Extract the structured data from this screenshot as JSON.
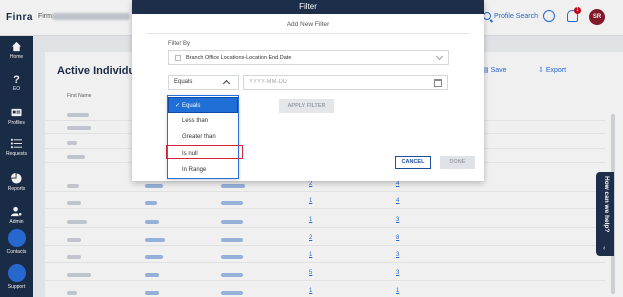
{
  "topbar": {
    "logo": "Finra",
    "firm_label": "Firm:",
    "profile_search": "Profile Search",
    "notification_count": "1",
    "avatar_initials": "SR"
  },
  "sidebar": {
    "items": [
      {
        "label": "Home",
        "icon": "home-icon"
      },
      {
        "label": "EO",
        "icon": "question-icon"
      },
      {
        "label": "Profiles",
        "icon": "id-card-icon"
      },
      {
        "label": "Requests",
        "icon": "list-icon"
      },
      {
        "label": "Reports",
        "icon": "pie-chart-icon"
      },
      {
        "label": "Admin",
        "icon": "user-gear-icon"
      },
      {
        "label": "Contacts",
        "icon": "contacts-icon"
      },
      {
        "label": "Support",
        "icon": "link-icon"
      }
    ]
  },
  "main": {
    "title": "Active Individu",
    "save_label": "Save",
    "export_label": "Export",
    "first_name_header": "First Name",
    "rows": [
      {
        "c1": "2",
        "c2": "4"
      },
      {
        "c1": "1",
        "c2": "4"
      },
      {
        "c1": "1",
        "c2": "3"
      },
      {
        "c1": "2",
        "c2": "8"
      },
      {
        "c1": "1",
        "c2": "3"
      },
      {
        "c1": "5",
        "c2": "3"
      },
      {
        "c1": "1",
        "c2": "1"
      }
    ]
  },
  "dialog": {
    "title": "Filter",
    "section_title": "Add New Filter",
    "filter_by_label": "Filter By",
    "filter_by_value": "Branch Office Locations-Location End Date",
    "operator_value": "Equals",
    "date_placeholder": "YYYY-MM-DD",
    "apply_label": "APPLY FILTER",
    "cancel_label": "CANCEL",
    "done_label": "DONE"
  },
  "operator_options": [
    {
      "label": "Equals",
      "selected": true
    },
    {
      "label": "Less than",
      "selected": false
    },
    {
      "label": "Greater than",
      "selected": false
    },
    {
      "label": "Is null",
      "selected": false,
      "highlighted": true
    },
    {
      "label": "In Range",
      "selected": false
    }
  ],
  "help": {
    "label": "How can we help?"
  },
  "colors": {
    "navy": "#1c2e4a",
    "accent_blue": "#2a6fdb",
    "selected_blue": "#1f6fd6",
    "highlight_red": "#d0263b"
  }
}
